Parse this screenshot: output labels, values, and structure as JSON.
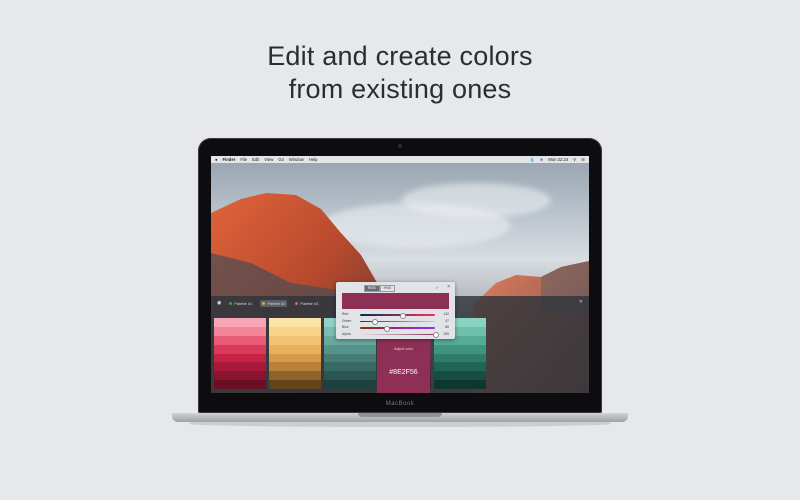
{
  "headline": {
    "line1": "Edit and create colors",
    "line2": "from existing ones"
  },
  "laptop": {
    "brand": "MacBook"
  },
  "menubar": {
    "apple": "",
    "items": [
      "Finder",
      "File",
      "Edit",
      "View",
      "Go",
      "Window",
      "Help"
    ],
    "clock": "Mon 22:24",
    "right_icons": [
      "droplet-icon",
      "wifi-icon",
      "menu-icon"
    ]
  },
  "app": {
    "tabs": [
      {
        "label": "Palette #1",
        "color": "#2ea84a",
        "active": false
      },
      {
        "label": "Palette #2",
        "color": "#e0a83a",
        "active": true
      },
      {
        "label": "Palette #3",
        "color": "#d96a3a",
        "active": false
      }
    ],
    "swatches": [
      {
        "colors": [
          "#f6a6b4",
          "#f28597",
          "#e85a76",
          "#da3a5a",
          "#c42246",
          "#a8183a",
          "#8a1430",
          "#6a0e24"
        ]
      },
      {
        "colors": [
          "#fbe2a6",
          "#f8d48a",
          "#f2c272",
          "#e9b05c",
          "#d79a48",
          "#b88038",
          "#8e6228",
          "#64441a"
        ]
      },
      {
        "colors": [
          "#8fd2c8",
          "#7bbdb2",
          "#68a89e",
          "#56938a",
          "#467e77",
          "#386a64",
          "#2b5550",
          "#1f413d"
        ]
      },
      {
        "colors": [
          "#c25a86",
          "#b04a77",
          "#9c3d69",
          "#8e2f56",
          "#7c2549",
          "#6a1c3d",
          "#581431",
          "#460d26"
        ]
      },
      {
        "colors": [
          "#88d4c0",
          "#6ec0aa",
          "#55ab94",
          "#3f947f",
          "#2d7d69",
          "#216555",
          "#174e42",
          "#0e3730"
        ]
      }
    ],
    "popover": {
      "modes": [
        "RGB",
        "HSB"
      ],
      "active_mode": "RGB",
      "preview_color": "#8e2f56",
      "sliders": [
        {
          "label": "Red",
          "value": "142",
          "fraction": 0.56,
          "gradient": "linear-gradient(90deg,#002f56,#ff2f56)"
        },
        {
          "label": "Green",
          "value": "47",
          "fraction": 0.18,
          "gradient": "linear-gradient(90deg,#8e0056,#8eff56)"
        },
        {
          "label": "Blue",
          "value": "86",
          "fraction": 0.34,
          "gradient": "linear-gradient(90deg,#8e2f00,#8e2fff)"
        },
        {
          "label": "Alpha",
          "value": "255",
          "fraction": 1.0,
          "gradient": "linear-gradient(90deg,#e4e4e6,#8e2f56)"
        }
      ]
    },
    "adjust": {
      "label": "Adjust color",
      "hex": "#8E2F56"
    }
  }
}
